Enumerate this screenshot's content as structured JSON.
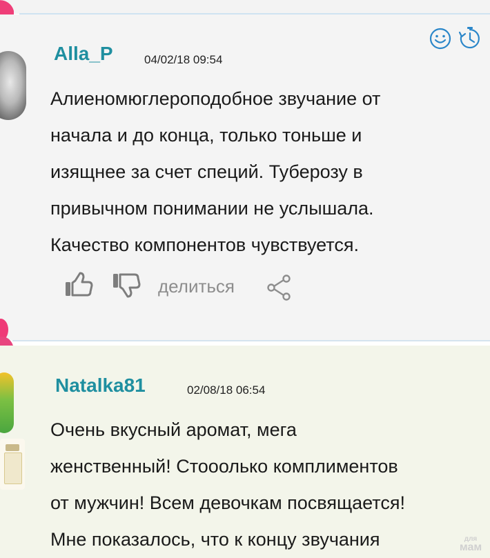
{
  "header": {
    "icons": [
      "smile-icon",
      "timer-icon"
    ]
  },
  "comments": [
    {
      "username": "Alla_P",
      "timestamp": "04/02/18 09:54",
      "text_lines": [
        "Алиеномюглероподобное звучание от",
        "начала и до конца, только тоньше и",
        "изящнее за счет специй. Туберозу в",
        "привычном понимании не услышала.",
        "Качество компонентов чувствуется."
      ],
      "actions": {
        "like_icon": "thumbs-up-icon",
        "dislike_icon": "thumbs-down-icon",
        "share_label": "делиться",
        "share_icon": "share-icon"
      }
    },
    {
      "username": "Natalka81",
      "timestamp": "02/08/18 06:54",
      "text_lines": [
        "Очень вкусный аромат, мега",
        "женственный! Стооолько комплиментов",
        "от мужчин! Всем девочкам посвящается!",
        "Мне показалось, что к концу звучания"
      ]
    }
  ],
  "watermark": {
    "line1": "для",
    "line2": "мам"
  },
  "colors": {
    "username": "#1f8fa0",
    "accent_blue": "#1f8fa0",
    "comment1_bg": "#f4f4f4",
    "comment2_bg": "#f3f5ea",
    "action_gray": "#8d8d8d"
  }
}
